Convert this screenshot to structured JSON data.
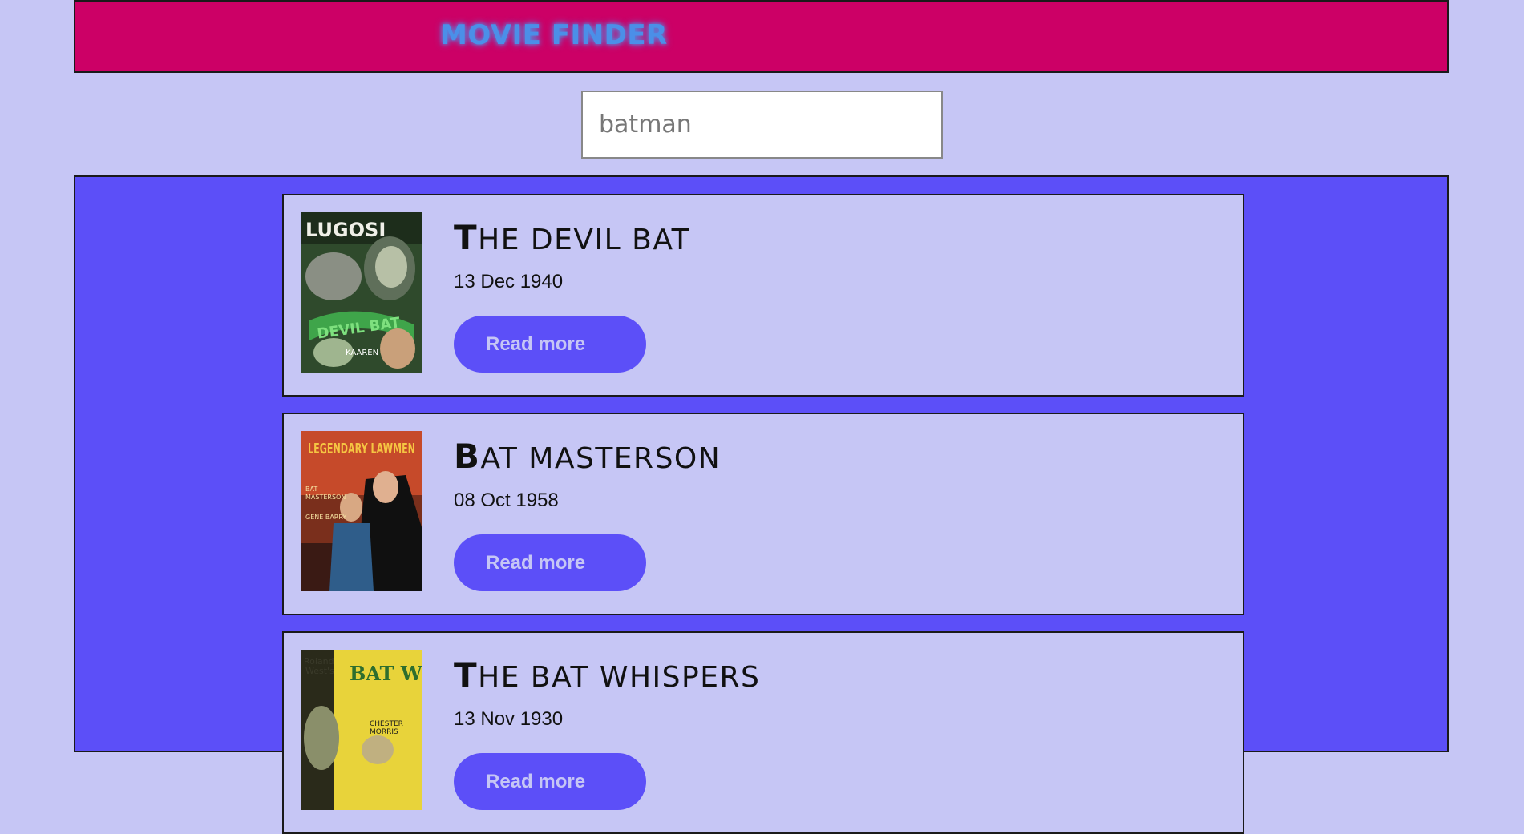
{
  "header": {
    "logo_text": "MOVIE FINDER"
  },
  "search": {
    "value": "batman"
  },
  "results": [
    {
      "title": "THE DEVIL BAT",
      "date": "13 Dec 1940",
      "button_label": "Read more",
      "poster_text": "LUGOSI"
    },
    {
      "title": "BAT MASTERSON",
      "date": "08 Oct 1958",
      "button_label": "Read more",
      "poster_text": "LEGENDARY LAWMEN"
    },
    {
      "title": "THE BAT WHISPERS",
      "date": "13 Nov 1930",
      "button_label": "Read more",
      "poster_text": "BAT Whispers"
    }
  ],
  "colors": {
    "page_bg": "#c6c6f5",
    "header_bg": "#cc0066",
    "logo": "#4b8fe8",
    "results_bg": "#5c4ff8",
    "button_bg": "#5c4ff8",
    "button_text": "#c6c6f5"
  }
}
